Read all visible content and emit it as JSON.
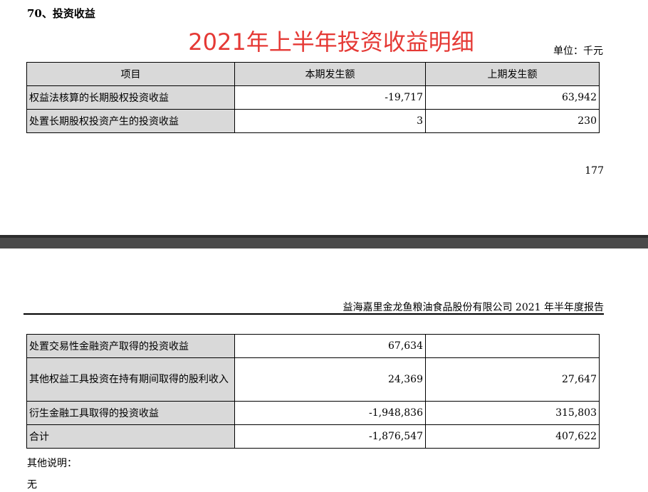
{
  "section_heading": "70、投资收益",
  "overlay_title": "2021年上半年投资收益明细",
  "unit_label": "单位：千元",
  "table_top": {
    "headers": [
      "项目",
      "本期发生额",
      "上期发生额"
    ],
    "rows": [
      {
        "item": "权益法核算的长期股权投资收益",
        "current": "-19,717",
        "previous": "63,942"
      },
      {
        "item": "处置长期股权投资产生的投资收益",
        "current": "3",
        "previous": "230"
      }
    ]
  },
  "page_number": "177",
  "report_header": {
    "company": "益海嘉里金龙鱼粮油食品股份有限公司",
    "report": " 2021 年半年度报告"
  },
  "table_bottom": {
    "rows": [
      {
        "item": "处置交易性金融资产取得的投资收益",
        "current": "67,634",
        "previous": ""
      },
      {
        "item": "其他权益工具投资在持有期间取得的股利收入",
        "current": "24,369",
        "previous": "27,647"
      },
      {
        "item": "衍生金融工具取得的投资收益",
        "current": "-1,948,836",
        "previous": "315,803"
      },
      {
        "item": "合计",
        "current": "-1,876,547",
        "previous": "407,622"
      }
    ]
  },
  "notes": {
    "label": "其他说明：",
    "value": "无"
  }
}
